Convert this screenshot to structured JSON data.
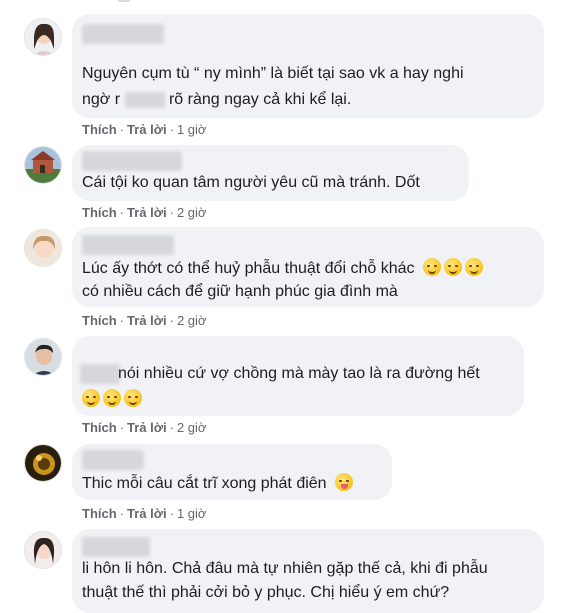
{
  "comments": [
    {
      "avatar": "profile-photo-woman",
      "lines": [
        "Nguyên cụm tù “ ny mình” là biết tại sao vk a hay nghi"
      ],
      "line2_pre": "ngờ r",
      "line2_post": "rõ ràng ngay cả khi kể lại.",
      "like": "Thích",
      "reply": "Trả lời",
      "time": "1 giờ"
    },
    {
      "avatar": "profile-photo-building",
      "lines": [
        "Cái tội ko quan tâm người yêu cũ mà tránh. Dốt"
      ],
      "like": "Thích",
      "reply": "Trả lời",
      "time": "2 giờ"
    },
    {
      "avatar": "profile-photo-woman",
      "lines": [
        "Lúc ấy thớt có thể huỷ phẫu thuật đổi chỗ khác",
        "có nhiều cách để giữ hạnh phúc gia đình mà"
      ],
      "emoji": [
        "face-emoji",
        "face-emoji",
        "face-emoji"
      ],
      "like": "Thích",
      "reply": "Trả lời",
      "time": "2 giờ"
    },
    {
      "avatar": "profile-photo-man",
      "lines": [
        "nói nhiều cứ vợ chồng mà mày tao là ra đường hết"
      ],
      "emoji": [
        "face-emoji",
        "face-emoji",
        "face-emoji"
      ],
      "like": "Thích",
      "reply": "Trả lời",
      "time": "2 giờ"
    },
    {
      "avatar": "profile-photo-dark",
      "lines": [
        "Thic mỗi câu cắt trĩ xong phát điên"
      ],
      "emoji": [
        "tongue-emoji"
      ],
      "like": "Thích",
      "reply": "Trả lời",
      "time": "1 giờ"
    },
    {
      "avatar": "profile-photo-woman",
      "lines": [
        "li hôn li hôn. Chả đâu mà tự nhiên gặp thế cả, khi đi phẫu",
        "thuật thế thì phải cởi bỏ y phục. Chị hiểu ý em chứ?"
      ]
    }
  ],
  "colors": {
    "bubble": "#f0f2f5",
    "meta": "#65676b",
    "text": "#1c1e21"
  }
}
